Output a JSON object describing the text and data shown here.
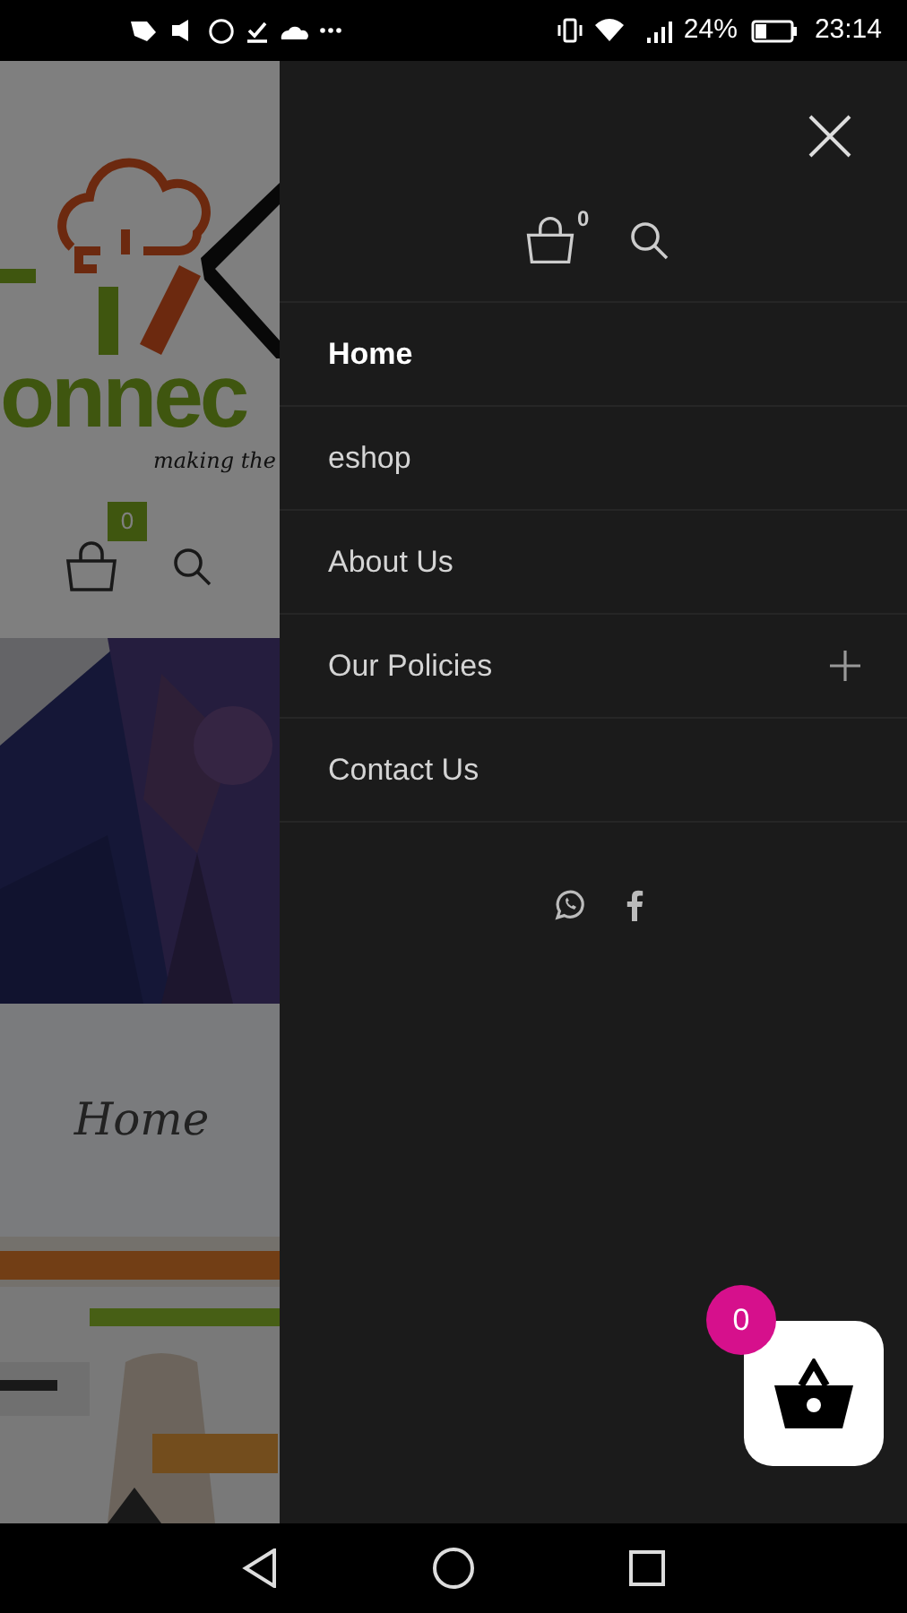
{
  "status_bar": {
    "battery": "24%",
    "time": "23:14"
  },
  "page": {
    "logo_text": "onnec",
    "tagline": "making the",
    "cart_count": "0",
    "heading": "Home"
  },
  "drawer": {
    "cart_count": "0",
    "menu": [
      {
        "label": "Home",
        "selected": true,
        "expandable": false
      },
      {
        "label": "eshop",
        "selected": false,
        "expandable": false
      },
      {
        "label": "About Us",
        "selected": false,
        "expandable": false
      },
      {
        "label": "Our Policies",
        "selected": false,
        "expandable": true
      },
      {
        "label": "Contact Us",
        "selected": false,
        "expandable": false
      }
    ]
  },
  "floating_cart": {
    "count": "0"
  }
}
